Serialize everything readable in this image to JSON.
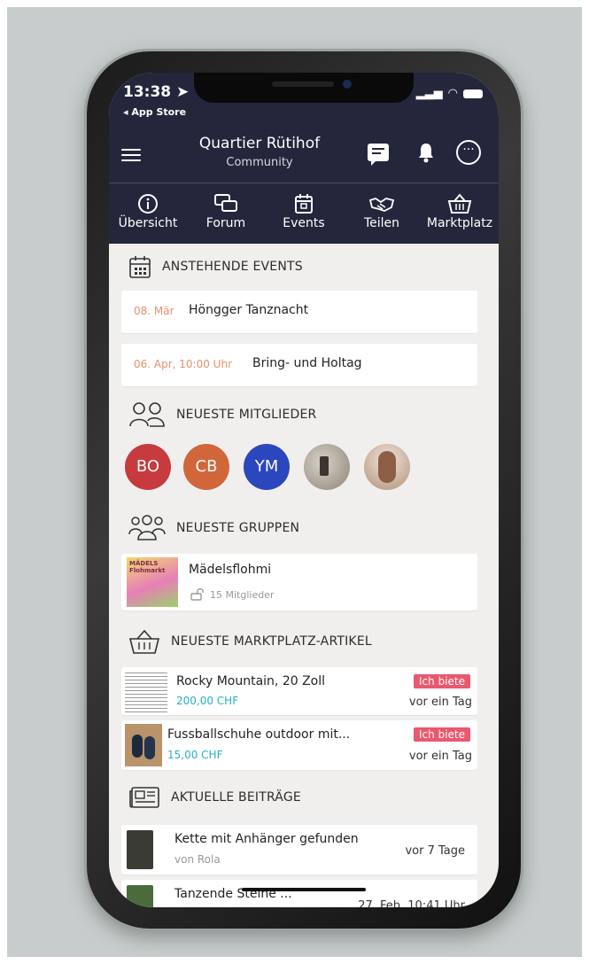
{
  "status": {
    "time": "13:38 ➤",
    "back": "◂ App Store"
  },
  "header": {
    "title": "Quartier Rütihof",
    "subtitle": "Community"
  },
  "nav": {
    "tabs": [
      {
        "label": "Übersicht",
        "icon": "info-icon"
      },
      {
        "label": "Forum",
        "icon": "chat-bubbles-icon"
      },
      {
        "label": "Events",
        "icon": "calendar-icon"
      },
      {
        "label": "Teilen",
        "icon": "handshake-icon"
      },
      {
        "label": "Marktplatz",
        "icon": "basket-icon"
      }
    ]
  },
  "events": {
    "heading": "ANSTEHENDE EVENTS",
    "items": [
      {
        "date": "08. Mär",
        "title": "Höngger Tanznacht"
      },
      {
        "date": "06. Apr, 10:00 Uhr",
        "title": "Bring- und Holtag"
      }
    ]
  },
  "members": {
    "heading": "NEUESTE MITGLIEDER",
    "avatars": [
      {
        "initials": "BO",
        "color": "#c73a3d"
      },
      {
        "initials": "CB",
        "color": "#d0663a"
      },
      {
        "initials": "YM",
        "color": "#2c46bd"
      },
      {
        "initials": "",
        "color": "#8d8377"
      },
      {
        "initials": "",
        "color": "#b0907a"
      }
    ]
  },
  "groups": {
    "heading": "NEUESTE GRUPPEN",
    "items": [
      {
        "name": "Mädelsflohmi",
        "members": "15 Mitglieder",
        "thumb_text": "MÄDELS Flohmarkt"
      }
    ]
  },
  "market": {
    "heading": "NEUESTE MARKTPLATZ-ARTIKEL",
    "items": [
      {
        "title": "Rocky Mountain, 20 Zoll",
        "price": "200,00 CHF",
        "badge": "Ich biete",
        "ago": "vor ein Tag"
      },
      {
        "title": "Fussballschuhe outdoor mit...",
        "price": "15,00 CHF",
        "badge": "Ich biete",
        "ago": "vor ein Tag"
      }
    ]
  },
  "posts": {
    "heading": "AKTUELLE BEITRÄGE",
    "items": [
      {
        "title": "Kette mit Anhänger gefunden",
        "author": "von Rola",
        "ago": "vor 7 Tage"
      },
      {
        "title": "Tanzende Steine ...",
        "author": "",
        "ago": "27. Feb, 10:41 Uhr"
      }
    ]
  },
  "colors": {
    "header_bg": "#24263c",
    "accent_date": "#e8906a",
    "badge": "#e9586f",
    "price": "#25b0c4"
  }
}
